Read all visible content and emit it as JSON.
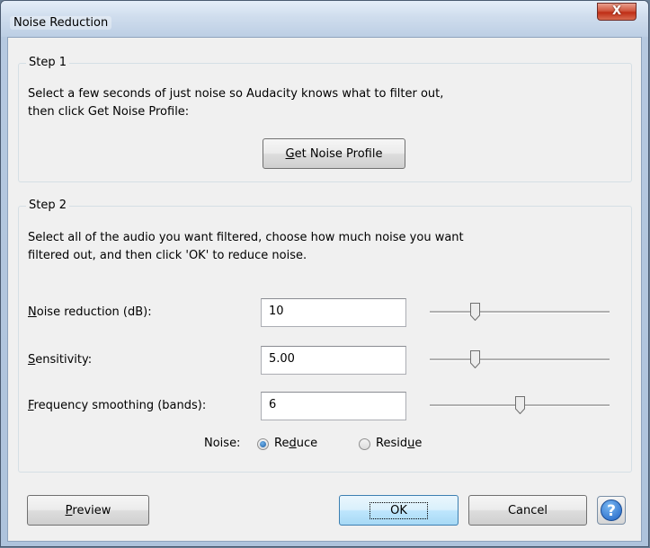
{
  "window": {
    "title": "Noise Reduction",
    "close_label": "X"
  },
  "step1": {
    "label": "Step 1",
    "line1": "Select a few seconds of just noise so Audacity knows what to filter out,",
    "line2": "then click Get Noise Profile:",
    "button_mnemonic": "G",
    "button_rest": "et Noise Profile"
  },
  "step2": {
    "label": "Step 2",
    "line1": "Select all of the audio you want filtered, choose how much noise you want",
    "line2": "filtered out, and then click 'OK' to reduce noise.",
    "params": [
      {
        "mnemonic": "N",
        "rest": "oise reduction (dB):",
        "value": "10",
        "slider_fraction": 0.24
      },
      {
        "mnemonic": "S",
        "rest": "ensitivity:",
        "value": "5.00",
        "slider_fraction": 0.24
      },
      {
        "mnemonic": "F",
        "rest": "requency smoothing (bands):",
        "value": "6",
        "slider_fraction": 0.5
      }
    ],
    "noise_label": "Noise:",
    "reduce_pre": "Re",
    "reduce_mnemonic": "d",
    "reduce_post": "uce",
    "residue_pre": "Resid",
    "residue_mnemonic": "u",
    "residue_post": "e",
    "selected": "Reduce"
  },
  "footer": {
    "preview_mnemonic": "P",
    "preview_rest": "review",
    "ok_label": "OK",
    "cancel_label": "Cancel",
    "help_label": "?"
  }
}
